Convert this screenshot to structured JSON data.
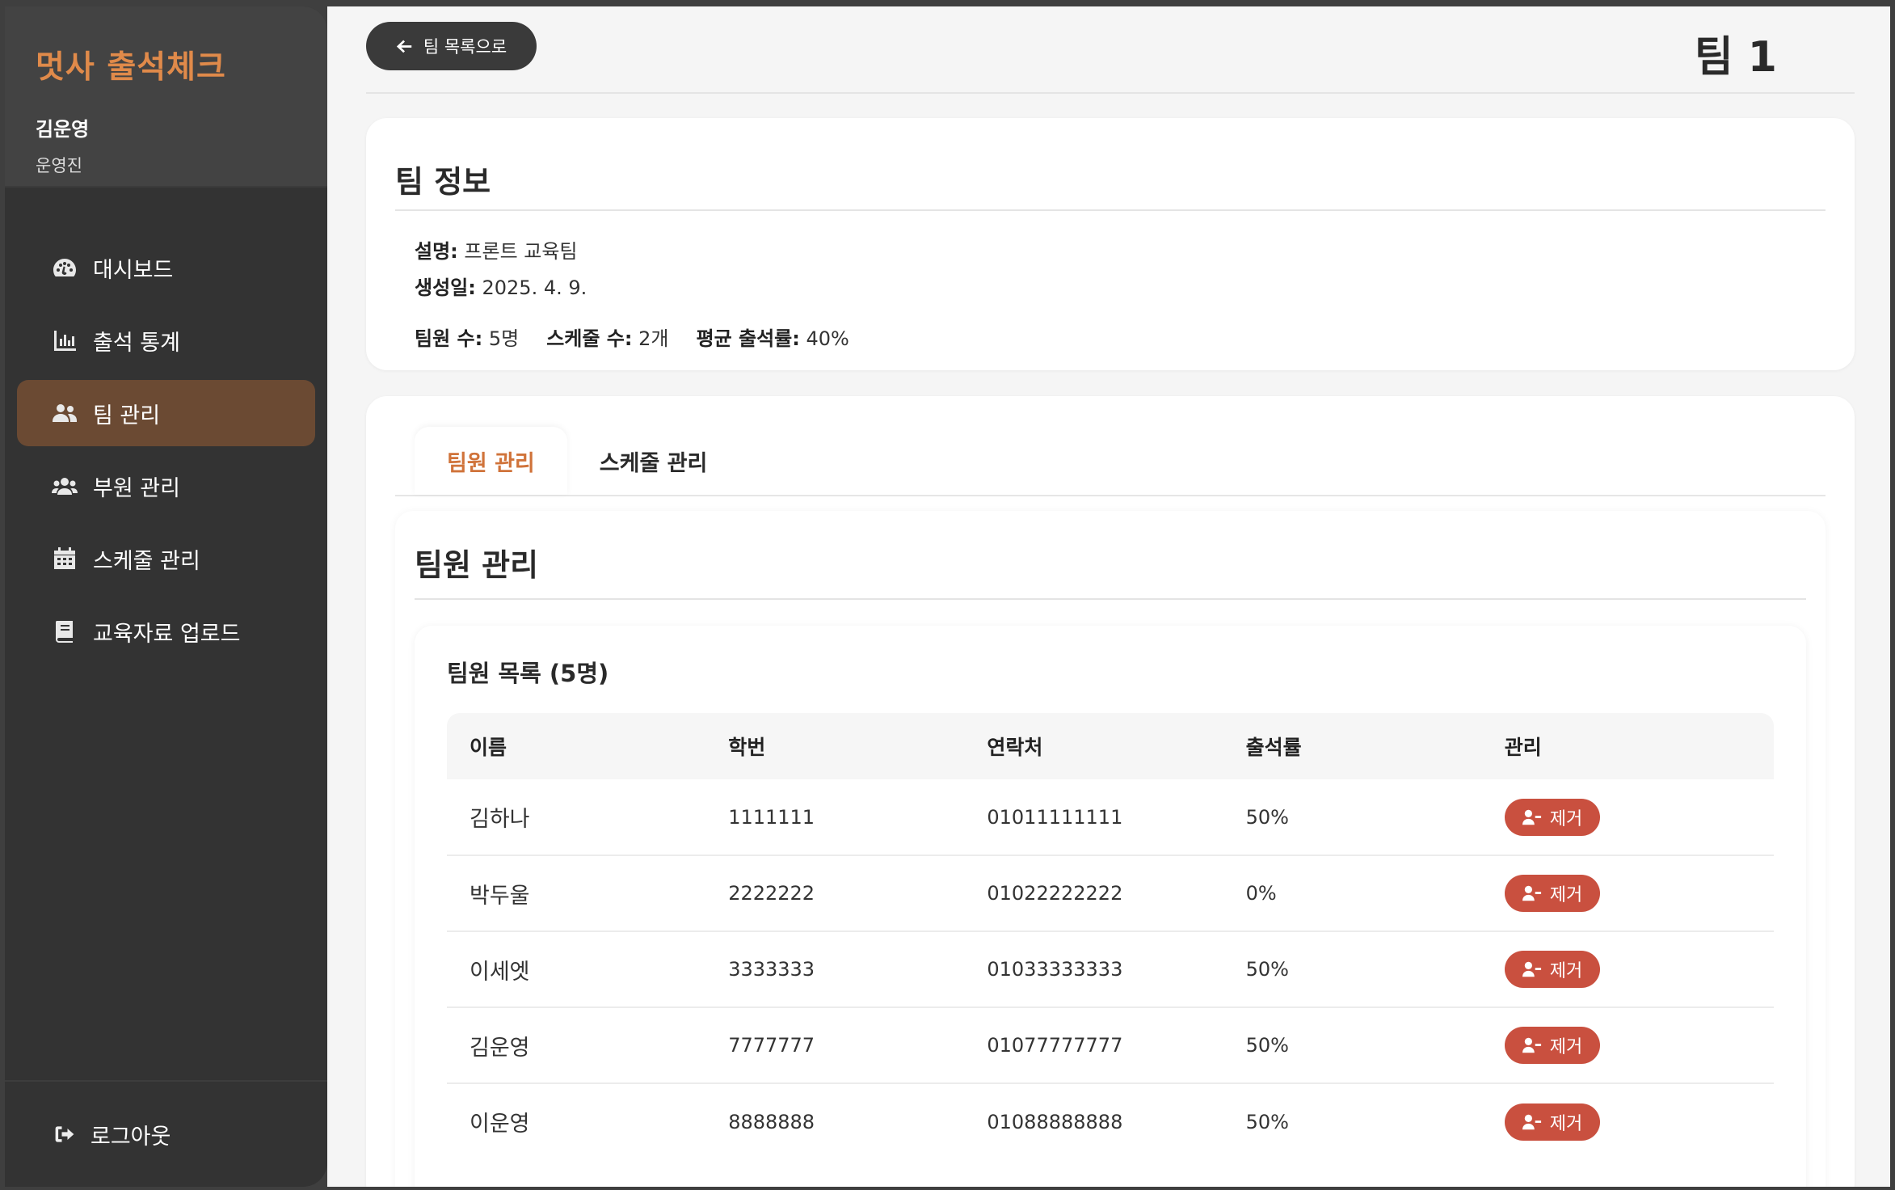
{
  "sidebar": {
    "brand": "멋사 출석체크",
    "user_name": "김운영",
    "user_role": "운영진",
    "items": [
      {
        "label": "대시보드",
        "icon": "dashboard-icon"
      },
      {
        "label": "출석 통계",
        "icon": "bar-chart-icon"
      },
      {
        "label": "팀 관리",
        "icon": "users-icon",
        "active": true
      },
      {
        "label": "부원 관리",
        "icon": "group-icon"
      },
      {
        "label": "스케줄 관리",
        "icon": "calendar-icon"
      },
      {
        "label": "교육자료 업로드",
        "icon": "book-icon"
      }
    ],
    "logout_label": "로그아웃"
  },
  "topbar": {
    "back_label": "팀 목록으로",
    "title": "팀 1"
  },
  "team_info": {
    "heading": "팀 정보",
    "desc_label": "설명:",
    "desc_value": "프론트 교육팀",
    "created_label": "생성일:",
    "created_value": "2025. 4. 9.",
    "members_label": "팀원 수:",
    "members_value": "5명",
    "schedules_label": "스케줄 수:",
    "schedules_value": "2개",
    "avg_label": "평균 출석률:",
    "avg_value": "40%"
  },
  "tabs": [
    {
      "label": "팀원 관리",
      "active": true
    },
    {
      "label": "스케줄 관리",
      "active": false
    }
  ],
  "section": {
    "heading": "팀원 관리",
    "list_title": "팀원 목록 (5명)",
    "columns": [
      "이름",
      "학번",
      "연락처",
      "출석률",
      "관리"
    ],
    "remove_label": "제거",
    "rows": [
      {
        "name": "김하나",
        "id": "1111111",
        "phone": "01011111111",
        "rate": "50%"
      },
      {
        "name": "박두울",
        "id": "2222222",
        "phone": "01022222222",
        "rate": "0%"
      },
      {
        "name": "이세엣",
        "id": "3333333",
        "phone": "01033333333",
        "rate": "50%"
      },
      {
        "name": "김운영",
        "id": "7777777",
        "phone": "01077777777",
        "rate": "50%"
      },
      {
        "name": "이운영",
        "id": "8888888",
        "phone": "01088888888",
        "rate": "50%"
      }
    ]
  },
  "colors": {
    "accent": "#e08a4a",
    "active_nav": "#6b4a33",
    "remove": "#c9503f",
    "sidebar": "#333333"
  }
}
